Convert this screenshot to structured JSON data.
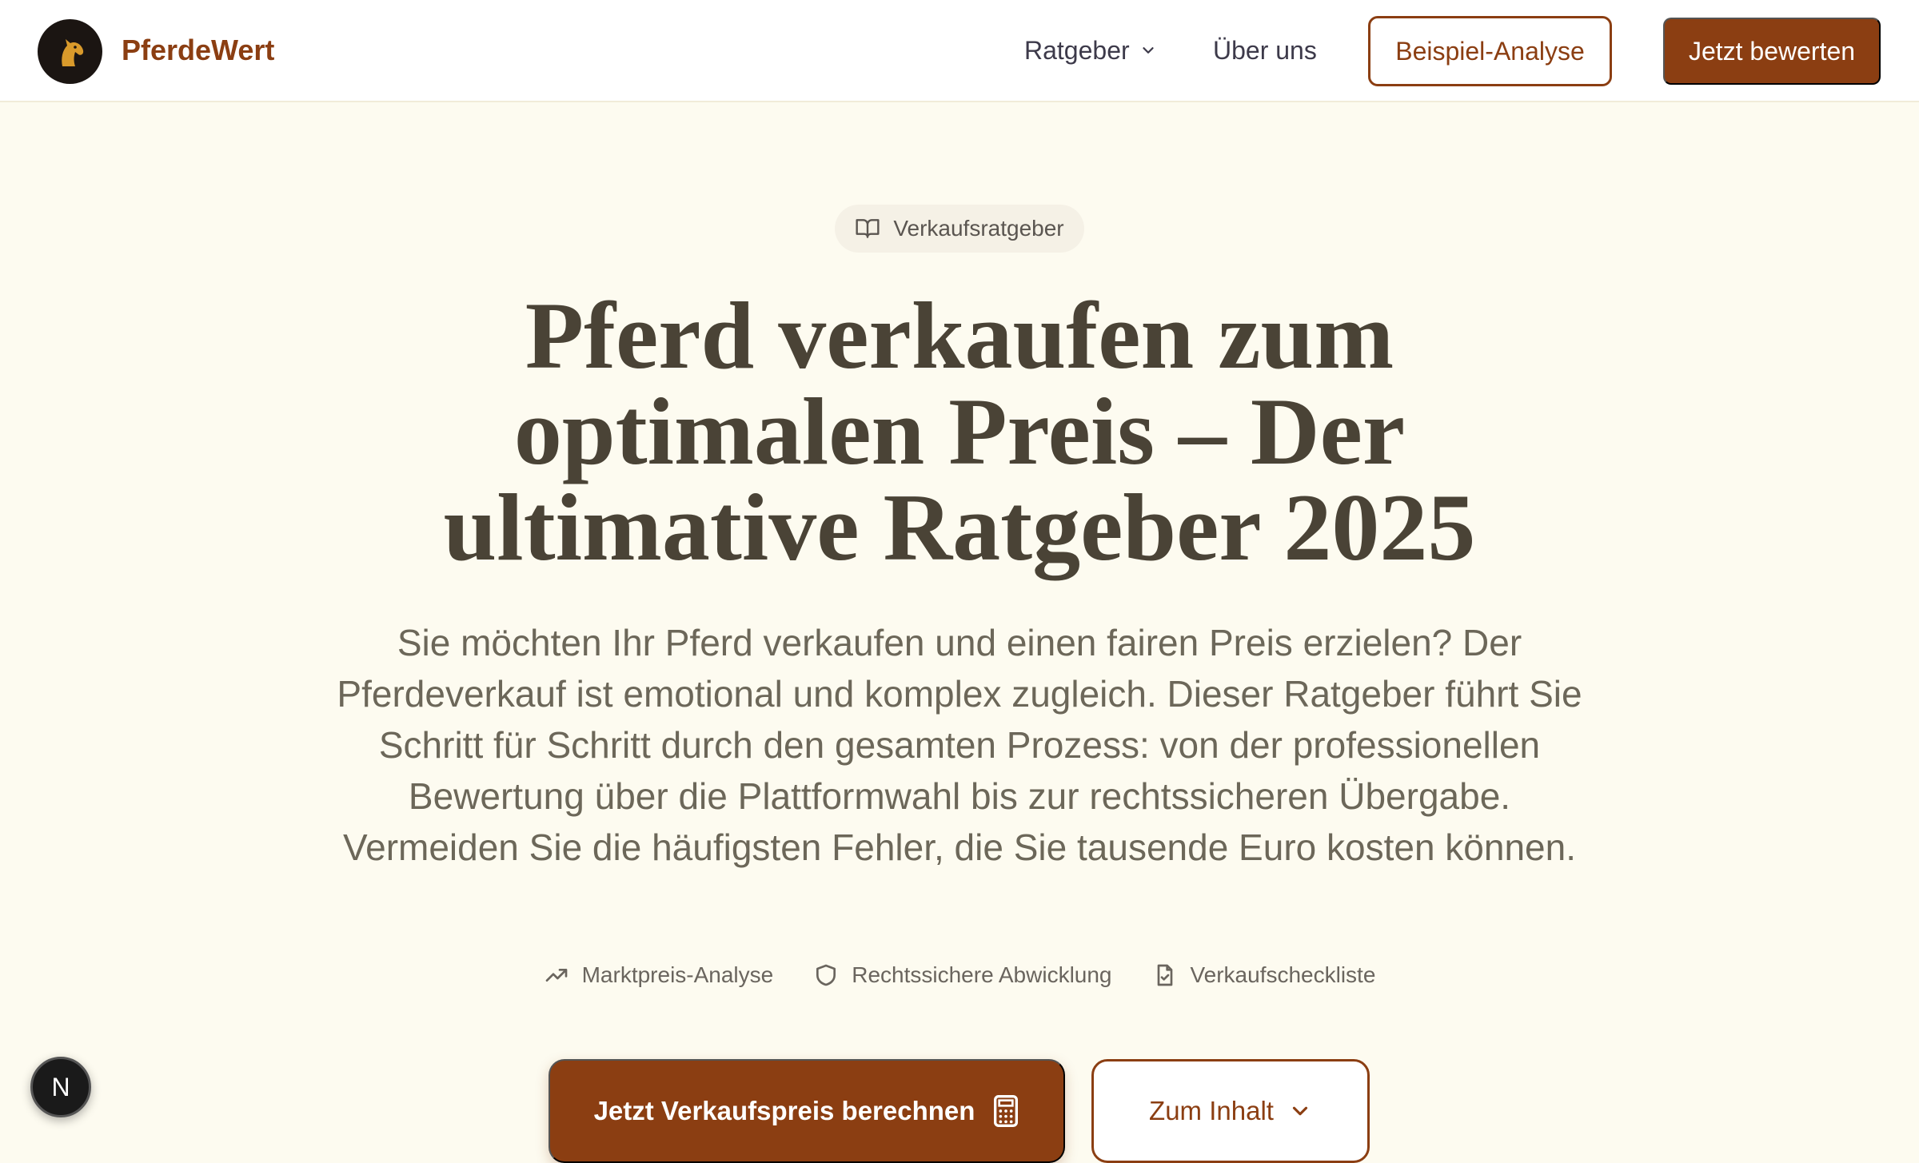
{
  "header": {
    "brand": "PferdeWert",
    "nav": {
      "ratgeber": "Ratgeber",
      "ueber_uns": "Über uns"
    },
    "example_button": "Beispiel-Analyse",
    "cta_button": "Jetzt bewerten"
  },
  "hero": {
    "badge": "Verkaufsratgeber",
    "headline_lines": [
      "Pferd verkaufen zum",
      "optimalen Preis – Der",
      "ultimative Ratgeber 2025"
    ],
    "lead": "Sie möchten Ihr Pferd verkaufen und einen fairen Preis erzielen? Der Pferdeverkauf ist emotional und komplex zugleich. Dieser Ratgeber führt Sie Schritt für Schritt durch den gesamten Prozess: von der professionellen Bewertung über die Plattformwahl bis zur rechtssicheren Übergabe. Vermeiden Sie die häufigsten Fehler, die Sie tausende Euro kosten können.",
    "features": [
      {
        "label": "Marktpreis-Analyse",
        "icon": "trending-up-icon"
      },
      {
        "label": "Rechtssichere Abwicklung",
        "icon": "shield-icon"
      },
      {
        "label": "Verkaufscheckliste",
        "icon": "file-check-icon"
      }
    ],
    "primary_cta": "Jetzt Verkaufspreis berechnen",
    "secondary_cta": "Zum Inhalt"
  },
  "dev_badge": "N",
  "colors": {
    "brand": "#8b3e12",
    "background": "#fdfbf0",
    "headline": "#4a4336"
  }
}
